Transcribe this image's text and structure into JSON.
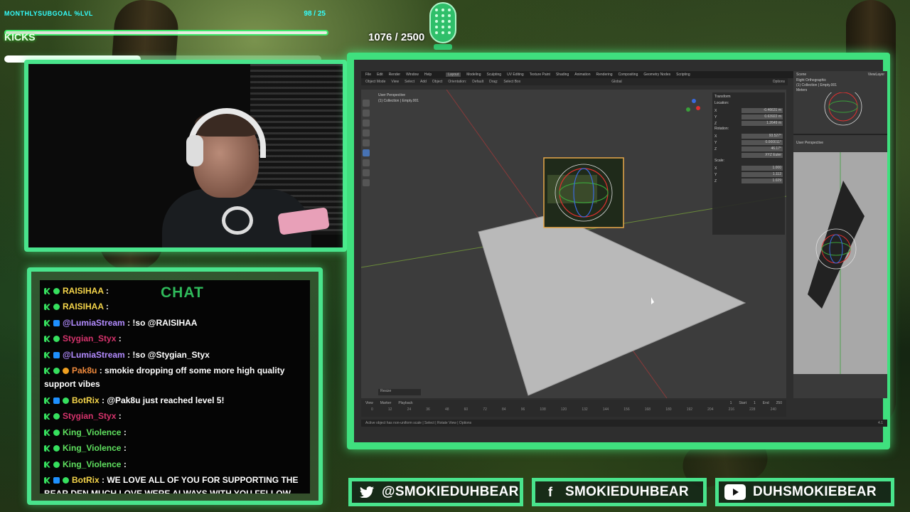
{
  "goals": {
    "monthly_label": "MONTHLYSUBGOAL %LVL",
    "monthly_value": "98 / 25",
    "kicks_label": "KICKS",
    "kicks_count": "1076 / 2500",
    "kicks_progress_fraction": 0.43
  },
  "chat": {
    "title": "CHAT",
    "messages": [
      {
        "user": "RAISIHAA",
        "user_color": "#f5d54a",
        "text": "",
        "badges": [
          "k",
          "shield"
        ]
      },
      {
        "user": "RAISIHAA",
        "user_color": "#f5d54a",
        "text": "",
        "badges": [
          "k",
          "shield"
        ]
      },
      {
        "user": "@LumiaStream",
        "user_color": "#b38cff",
        "text": "!so @RAISIHAA",
        "badges": [
          "k",
          "blue"
        ]
      },
      {
        "user": "Stygian_Styx",
        "user_color": "#d6336c",
        "text": "",
        "badges": [
          "k",
          "shield"
        ]
      },
      {
        "user": "@LumiaStream",
        "user_color": "#b38cff",
        "text": "!so @Stygian_Styx",
        "badges": [
          "k",
          "blue"
        ]
      },
      {
        "user": "Pak8u",
        "user_color": "#f08a3c",
        "text": "smokie dropping off some more high quality support vibes",
        "badges": [
          "k",
          "shield",
          "sub"
        ]
      },
      {
        "user": "BotRix",
        "user_color": "#f5d54a",
        "text": "@Pak8u just reached level 5!",
        "badges": [
          "k",
          "blue",
          "shield"
        ]
      },
      {
        "user": "Stygian_Styx",
        "user_color": "#d6336c",
        "text": "",
        "badges": [
          "k",
          "shield"
        ]
      },
      {
        "user": "King_Violence",
        "user_color": "#5fe05f",
        "text": "",
        "badges": [
          "k",
          "shield"
        ]
      },
      {
        "user": "King_Violence",
        "user_color": "#5fe05f",
        "text": "",
        "badges": [
          "k",
          "shield"
        ]
      },
      {
        "user": "King_Violence",
        "user_color": "#5fe05f",
        "text": "",
        "badges": [
          "k",
          "shield"
        ]
      },
      {
        "user": "BotRix",
        "user_color": "#f5d54a",
        "text": "WE LOVE ALL OF YOU FOR SUPPORTING THE BEAR DEN MUCH LOVE WERE ALWAYS WITH YOU FELLOW STREAMERS",
        "badges": [
          "k",
          "blue",
          "shield"
        ]
      }
    ]
  },
  "blender": {
    "menu": [
      "File",
      "Edit",
      "Render",
      "Window",
      "Help"
    ],
    "workspaces": [
      "Layout",
      "Modeling",
      "Sculpting",
      "UV Editing",
      "Texture Paint",
      "Shading",
      "Animation",
      "Rendering",
      "Compositing",
      "Geometry Nodes",
      "Scripting"
    ],
    "active_workspace": "Layout",
    "header_items": [
      "Object Mode",
      "View",
      "Select",
      "Add",
      "Object"
    ],
    "orientation": "Orientation:",
    "orientation_value": "Default",
    "drag_label": "Drag:",
    "drag_value": "Select Box",
    "transform_orientation": "Global",
    "options": "Options",
    "viewport_title": "User Perspective",
    "viewport_collection": "(1) Collection | Empty.001",
    "npanel": {
      "title": "Transform",
      "location_label": "Location:",
      "location": [
        {
          "axis": "X",
          "value": "-0.46631 m"
        },
        {
          "axis": "Y",
          "value": "0.63922 m"
        },
        {
          "axis": "Z",
          "value": "1.2649 m"
        }
      ],
      "rotation_label": "Rotation:",
      "rotation": [
        {
          "axis": "X",
          "value": "93.527°"
        },
        {
          "axis": "Y",
          "value": "0.000011°"
        },
        {
          "axis": "Z",
          "value": "46.17°"
        }
      ],
      "rotation_mode": "XYZ Euler",
      "scale_label": "Scale:",
      "scale": [
        {
          "axis": "X",
          "value": "1.000"
        },
        {
          "axis": "Y",
          "value": "1.112"
        },
        {
          "axis": "Z",
          "value": "1.029"
        }
      ]
    },
    "side_top_label": "Right Orthographic",
    "side_top_collection": "(1) Collection | Empty.001",
    "side_top_units": "Meters",
    "side_bottom_label": "User Perspective",
    "scene_label": "Scene",
    "viewlayer_label": "ViewLayer",
    "timeline_items": [
      "View",
      "Marker",
      "Playback"
    ],
    "current_frame": "1",
    "start_label": "Start",
    "start_value": "1",
    "end_label": "End",
    "end_value": "250",
    "frame_ticks": [
      "0",
      "12",
      "24",
      "36",
      "48",
      "60",
      "72",
      "84",
      "96",
      "108",
      "120",
      "132",
      "144",
      "156",
      "168",
      "180",
      "192",
      "204",
      "216",
      "228",
      "240"
    ],
    "resize_label": "Resize",
    "status_text": "Active object has non-uniform scale  |  Select  |  Rotate View  |  Options",
    "version": "4.1"
  },
  "socials": [
    {
      "platform": "twitter",
      "icon": "twitter-icon",
      "handle": "@SMOKIEDUHBEAR"
    },
    {
      "platform": "facebook",
      "icon": "facebook-icon",
      "handle": "SMOKIEDUHBEAR"
    },
    {
      "platform": "youtube",
      "icon": "youtube-icon",
      "handle": "DUHSMOKIEBEAR"
    }
  ],
  "colors": {
    "accent_green": "#49e48c",
    "chat_title": "#2fb95a",
    "goal_cyan": "#33ffff",
    "blender_bg": "#3c3c3c"
  }
}
